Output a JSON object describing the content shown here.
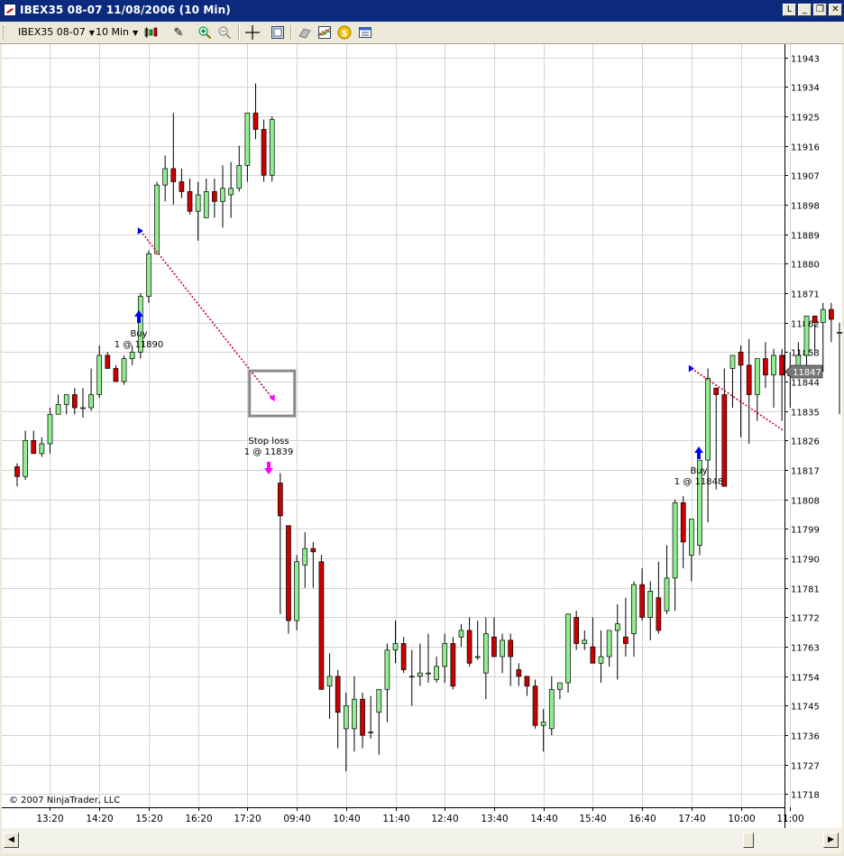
{
  "window": {
    "title": "IBEX35 08-07  11/08/2006  (10 Min)",
    "buttons": {
      "minimize": "_",
      "restore": "❐",
      "close": "✕",
      "layout": "L"
    }
  },
  "toolbar": {
    "instrument": "IBEX35 08-07",
    "interval": "10 Min"
  },
  "copyright": "© 2007 NinjaTrader, LLC",
  "colors": {
    "up": "#90ee90",
    "down": "#cc0000",
    "grid": "#d3d3d3",
    "buy_arrow": "#0000ff",
    "stop_arrow": "#ff00ff",
    "trade_line_loss": "#cc0033",
    "price_marker": "#777777"
  },
  "chart_data": {
    "type": "candlestick",
    "ylim": [
      11714,
      11947
    ],
    "y_ticks": [
      11718,
      11727,
      11736,
      11745,
      11754,
      11763,
      11772,
      11781,
      11790,
      11799,
      11808,
      11817,
      11826,
      11835,
      11844,
      11853,
      11862,
      11871,
      11880,
      11889,
      11898,
      11907,
      11916,
      11925,
      11934,
      11943
    ],
    "x_ticks": [
      {
        "label": "13:20",
        "bar": 4
      },
      {
        "label": "14:20",
        "bar": 10
      },
      {
        "label": "15:20",
        "bar": 16
      },
      {
        "label": "16:20",
        "bar": 22
      },
      {
        "label": "17:20",
        "bar": 28
      },
      {
        "label": "09:40",
        "bar": 34
      },
      {
        "label": "10:40",
        "bar": 40
      },
      {
        "label": "11:40",
        "bar": 46
      },
      {
        "label": "12:40",
        "bar": 52
      },
      {
        "label": "13:40",
        "bar": 58
      },
      {
        "label": "14:40",
        "bar": 64
      },
      {
        "label": "15:40",
        "bar": 70
      },
      {
        "label": "16:40",
        "bar": 76
      },
      {
        "label": "17:40",
        "bar": 82
      },
      {
        "label": "10:00",
        "bar": 88
      },
      {
        "label": "11:00",
        "bar": 94
      }
    ],
    "current_price": "11847",
    "ohlc": [
      [
        11818,
        11819,
        11812,
        11815
      ],
      [
        11815,
        11829,
        11814,
        11826
      ],
      [
        11826,
        11829,
        11823,
        11822
      ],
      [
        11822,
        11827,
        11821,
        11825
      ],
      [
        11825,
        11836,
        11822,
        11834
      ],
      [
        11834,
        11840,
        11834,
        11837
      ],
      [
        11837,
        11839,
        11834,
        11840
      ],
      [
        11840,
        11842,
        11834,
        11836
      ],
      [
        11836,
        11842,
        11833,
        11836
      ],
      [
        11836,
        11848,
        11835,
        11840
      ],
      [
        11840,
        11855,
        11839,
        11852
      ],
      [
        11852,
        11853,
        11848,
        11848
      ],
      [
        11848,
        11849,
        11844,
        11844
      ],
      [
        11844,
        11852,
        11843,
        11851
      ],
      [
        11851,
        11855,
        11849,
        11853
      ],
      [
        11853,
        11871,
        11851,
        11870
      ],
      [
        11870,
        11884,
        11868,
        11883
      ],
      [
        11883,
        11905,
        11883,
        11904
      ],
      [
        11904,
        11913,
        11899,
        11909
      ],
      [
        11909,
        11926,
        11898,
        11905
      ],
      [
        11905,
        11909,
        11900,
        11902
      ],
      [
        11902,
        11906,
        11895,
        11896
      ],
      [
        11896,
        11905,
        11887,
        11901
      ],
      [
        11894,
        11906,
        11894,
        11902
      ],
      [
        11902,
        11906,
        11894,
        11899
      ],
      [
        11899,
        11910,
        11891,
        11903
      ],
      [
        11901,
        11911,
        11894,
        11903
      ],
      [
        11903,
        11916,
        11902,
        11910
      ],
      [
        11910,
        11926,
        11905,
        11926
      ],
      [
        11926,
        11935,
        11918,
        11921
      ],
      [
        11921,
        11924,
        11905,
        11907
      ],
      [
        11907,
        11925,
        11905,
        11924
      ],
      [
        11813,
        11816,
        11773,
        11803
      ],
      [
        11800,
        11800,
        11767,
        11771
      ],
      [
        11771,
        11791,
        11768,
        11789
      ],
      [
        11788,
        11798,
        11781,
        11793
      ],
      [
        11793,
        11795,
        11781,
        11792
      ],
      [
        11789,
        11791,
        11750,
        11750
      ],
      [
        11751,
        11761,
        11741,
        11754
      ],
      [
        11754,
        11756,
        11732,
        11743
      ],
      [
        11738,
        11749,
        11725,
        11745
      ],
      [
        11738,
        11754,
        11731,
        11747
      ],
      [
        11747,
        11749,
        11732,
        11736
      ],
      [
        11737,
        11748,
        11735,
        11737
      ],
      [
        11743,
        11749,
        11730,
        11750
      ],
      [
        11750,
        11764,
        11740,
        11762
      ],
      [
        11762,
        11771,
        11758,
        11764
      ],
      [
        11764,
        11766,
        11755,
        11756
      ],
      [
        11754,
        11762,
        11745,
        11754
      ],
      [
        11754,
        11764,
        11751,
        11755
      ],
      [
        11755,
        11767,
        11752,
        11755
      ],
      [
        11753,
        11760,
        11752,
        11757
      ],
      [
        11757,
        11767,
        11752,
        11764
      ],
      [
        11764,
        11766,
        11750,
        11751
      ],
      [
        11766,
        11770,
        11763,
        11768
      ],
      [
        11768,
        11772,
        11757,
        11758
      ],
      [
        11760,
        11771,
        11759,
        11760
      ],
      [
        11755,
        11772,
        11747,
        11767
      ],
      [
        11766,
        11772,
        11763,
        11760
      ],
      [
        11760,
        11767,
        11755,
        11765
      ],
      [
        11765,
        11767,
        11751,
        11760
      ],
      [
        11756,
        11758,
        11751,
        11754
      ],
      [
        11754,
        11754,
        11748,
        11751
      ],
      [
        11751,
        11753,
        11738,
        11739
      ],
      [
        11739,
        11744,
        11731,
        11740
      ],
      [
        11738,
        11754,
        11736,
        11750
      ],
      [
        11750,
        11751,
        11747,
        11752
      ],
      [
        11752,
        11773,
        11749,
        11773
      ],
      [
        11772,
        11774,
        11762,
        11764
      ],
      [
        11764,
        11768,
        11762,
        11765
      ],
      [
        11763,
        11772,
        11758,
        11758
      ],
      [
        11758,
        11768,
        11752,
        11760
      ],
      [
        11760,
        11766,
        11757,
        11768
      ],
      [
        11768,
        11776,
        11753,
        11770
      ],
      [
        11766,
        11778,
        11760,
        11764
      ],
      [
        11767,
        11783,
        11760,
        11782
      ],
      [
        11782,
        11787,
        11771,
        11772
      ],
      [
        11772,
        11783,
        11765,
        11780
      ],
      [
        11778,
        11789,
        11767,
        11768
      ],
      [
        11774,
        11794,
        11773,
        11784
      ],
      [
        11784,
        11808,
        11774,
        11807
      ],
      [
        11807,
        11809,
        11787,
        11795
      ],
      [
        11791,
        11801,
        11783,
        11802
      ],
      [
        11794,
        11818,
        11791,
        11820
      ],
      [
        11820,
        11848,
        11801,
        11845
      ],
      [
        11842,
        11842,
        11811,
        11840
      ],
      [
        11840,
        11848,
        11812,
        11812
      ],
      [
        11848,
        11849,
        11836,
        11852
      ],
      [
        11853,
        11855,
        11827,
        11849
      ],
      [
        11849,
        11857,
        11825,
        11840
      ],
      [
        11840,
        11851,
        11832,
        11851
      ],
      [
        11851,
        11856,
        11842,
        11846
      ],
      [
        11846,
        11854,
        11836,
        11852
      ],
      [
        11852,
        11854,
        11832,
        11846
      ],
      [
        11846,
        11853,
        11836,
        11846
      ],
      [
        11846,
        11856,
        11846,
        11852
      ],
      [
        11852,
        11862,
        11848,
        11864
      ],
      [
        11864,
        11863,
        11852,
        11862
      ],
      [
        11862,
        11868,
        11847,
        11866
      ],
      [
        11866,
        11868,
        11856,
        11863
      ],
      [
        11859,
        11862,
        11834,
        11859
      ],
      [
        11859,
        11847,
        11840,
        11843
      ],
      [
        11843,
        11849,
        11840,
        11846
      ]
    ],
    "trades": [
      {
        "label": "Buy",
        "detail": "1 @ 11890",
        "type": "entry"
      },
      {
        "label": "Stop loss",
        "detail": "1 @ 11839",
        "type": "exit"
      },
      {
        "label": "Buy",
        "detail": "1 @ 11848",
        "type": "entry"
      }
    ]
  }
}
